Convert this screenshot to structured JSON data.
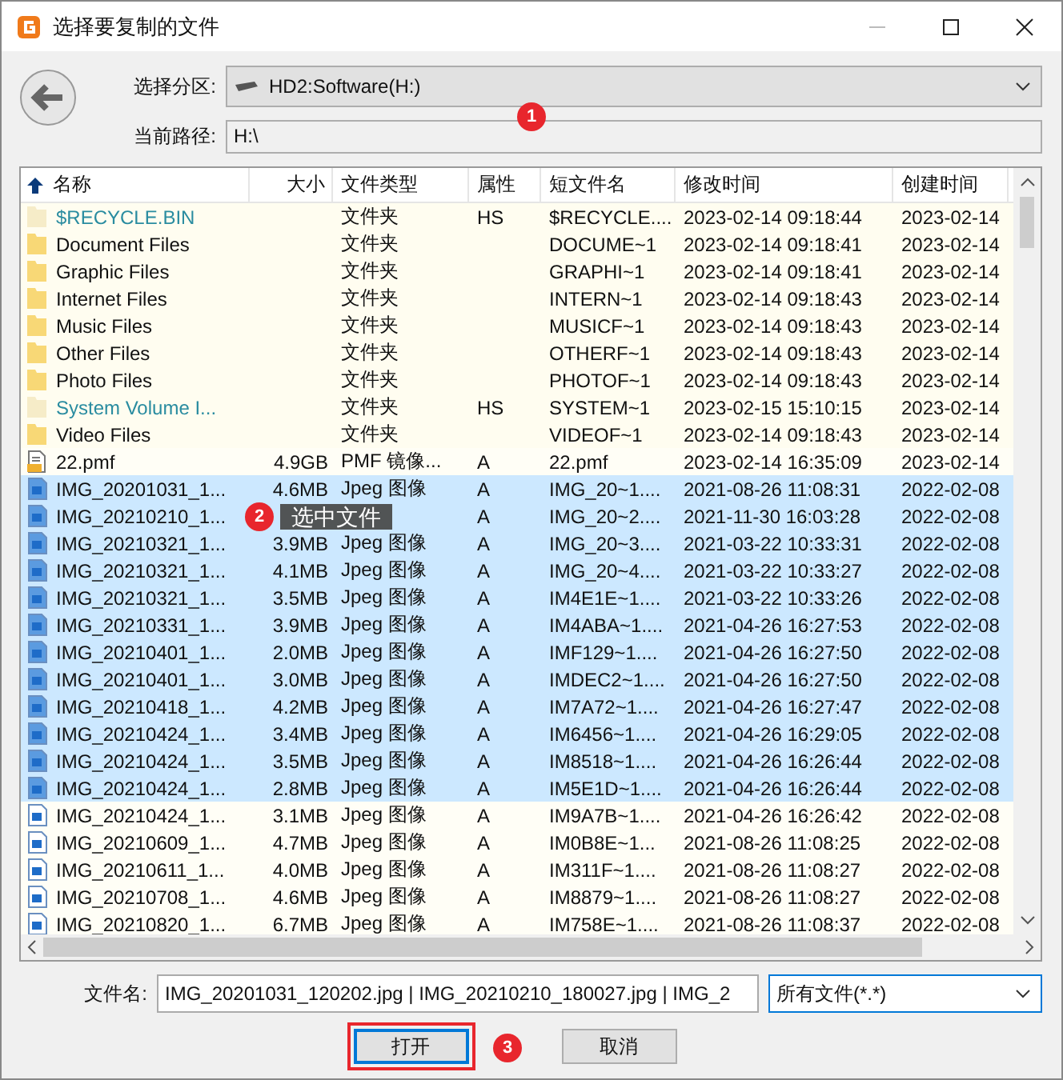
{
  "window": {
    "title": "选择要复制的文件"
  },
  "partition": {
    "label": "选择分区:",
    "value": "HD2:Software(H:)"
  },
  "path": {
    "label": "当前路径:",
    "value": "H:\\"
  },
  "files": {
    "columns": [
      "名称",
      "大小",
      "文件类型",
      "属性",
      "短文件名",
      "修改时间",
      "创建时间"
    ],
    "rows": [
      {
        "kind": "folder",
        "hidden": true,
        "selected": false,
        "name": "$RECYCLE.BIN",
        "type": "文件夹",
        "attr": "HS",
        "short": "$RECYCLE....",
        "modified": "2023-02-14 09:18:44",
        "created": "2023-02-14"
      },
      {
        "kind": "folder",
        "hidden": false,
        "selected": false,
        "name": "Document Files",
        "type": "文件夹",
        "short": "DOCUME~1",
        "modified": "2023-02-14 09:18:41",
        "created": "2023-02-14"
      },
      {
        "kind": "folder",
        "hidden": false,
        "selected": false,
        "name": "Graphic Files",
        "type": "文件夹",
        "short": "GRAPHI~1",
        "modified": "2023-02-14 09:18:41",
        "created": "2023-02-14"
      },
      {
        "kind": "folder",
        "hidden": false,
        "selected": false,
        "name": "Internet Files",
        "type": "文件夹",
        "short": "INTERN~1",
        "modified": "2023-02-14 09:18:43",
        "created": "2023-02-14"
      },
      {
        "kind": "folder",
        "hidden": false,
        "selected": false,
        "name": "Music Files",
        "type": "文件夹",
        "short": "MUSICF~1",
        "modified": "2023-02-14 09:18:43",
        "created": "2023-02-14"
      },
      {
        "kind": "folder",
        "hidden": false,
        "selected": false,
        "name": "Other Files",
        "type": "文件夹",
        "short": "OTHERF~1",
        "modified": "2023-02-14 09:18:43",
        "created": "2023-02-14"
      },
      {
        "kind": "folder",
        "hidden": false,
        "selected": false,
        "name": "Photo Files",
        "type": "文件夹",
        "short": "PHOTOF~1",
        "modified": "2023-02-14 09:18:43",
        "created": "2023-02-14"
      },
      {
        "kind": "folder",
        "hidden": true,
        "selected": false,
        "name": "System Volume I...",
        "type": "文件夹",
        "attr": "HS",
        "short": "SYSTEM~1",
        "modified": "2023-02-15 15:10:15",
        "created": "2023-02-14"
      },
      {
        "kind": "folder",
        "hidden": false,
        "selected": false,
        "name": "Video Files",
        "type": "文件夹",
        "short": "VIDEOF~1",
        "modified": "2023-02-14 09:18:43",
        "created": "2023-02-14"
      },
      {
        "kind": "file",
        "hidden": false,
        "selected": false,
        "name": "22.pmf",
        "size": "4.9GB",
        "type": "PMF 镜像...",
        "attr": "A",
        "short": "22.pmf",
        "modified": "2023-02-14 16:35:09",
        "created": "2023-02-14"
      },
      {
        "kind": "image",
        "hidden": false,
        "selected": true,
        "name": "IMG_20201031_1...",
        "size": "4.6MB",
        "type": "Jpeg 图像",
        "attr": "A",
        "short": "IMG_20~1....",
        "modified": "2021-08-26 11:08:31",
        "created": "2022-02-08"
      },
      {
        "kind": "image",
        "hidden": false,
        "selected": true,
        "name": "IMG_20210210_1...",
        "attr": "A",
        "short": "IMG_20~2....",
        "modified": "2021-11-30 16:03:28",
        "created": "2022-02-08"
      },
      {
        "kind": "image",
        "hidden": false,
        "selected": true,
        "name": "IMG_20210321_1...",
        "size": "3.9MB",
        "type": "Jpeg 图像",
        "attr": "A",
        "short": "IMG_20~3....",
        "modified": "2021-03-22 10:33:31",
        "created": "2022-02-08"
      },
      {
        "kind": "image",
        "hidden": false,
        "selected": true,
        "name": "IMG_20210321_1...",
        "size": "4.1MB",
        "type": "Jpeg 图像",
        "attr": "A",
        "short": "IMG_20~4....",
        "modified": "2021-03-22 10:33:27",
        "created": "2022-02-08"
      },
      {
        "kind": "image",
        "hidden": false,
        "selected": true,
        "name": "IMG_20210321_1...",
        "size": "3.5MB",
        "type": "Jpeg 图像",
        "attr": "A",
        "short": "IM4E1E~1....",
        "modified": "2021-03-22 10:33:26",
        "created": "2022-02-08"
      },
      {
        "kind": "image",
        "hidden": false,
        "selected": true,
        "name": "IMG_20210331_1...",
        "size": "3.9MB",
        "type": "Jpeg 图像",
        "attr": "A",
        "short": "IM4ABA~1....",
        "modified": "2021-04-26 16:27:53",
        "created": "2022-02-08"
      },
      {
        "kind": "image",
        "hidden": false,
        "selected": true,
        "name": "IMG_20210401_1...",
        "size": "2.0MB",
        "type": "Jpeg 图像",
        "attr": "A",
        "short": "IMF129~1....",
        "modified": "2021-04-26 16:27:50",
        "created": "2022-02-08"
      },
      {
        "kind": "image",
        "hidden": false,
        "selected": true,
        "name": "IMG_20210401_1...",
        "size": "3.0MB",
        "type": "Jpeg 图像",
        "attr": "A",
        "short": "IMDEC2~1....",
        "modified": "2021-04-26 16:27:50",
        "created": "2022-02-08"
      },
      {
        "kind": "image",
        "hidden": false,
        "selected": true,
        "name": "IMG_20210418_1...",
        "size": "4.2MB",
        "type": "Jpeg 图像",
        "attr": "A",
        "short": "IM7A72~1....",
        "modified": "2021-04-26 16:27:47",
        "created": "2022-02-08"
      },
      {
        "kind": "image",
        "hidden": false,
        "selected": true,
        "name": "IMG_20210424_1...",
        "size": "3.4MB",
        "type": "Jpeg 图像",
        "attr": "A",
        "short": "IM6456~1....",
        "modified": "2021-04-26 16:29:05",
        "created": "2022-02-08"
      },
      {
        "kind": "image",
        "hidden": false,
        "selected": true,
        "name": "IMG_20210424_1...",
        "size": "3.5MB",
        "type": "Jpeg 图像",
        "attr": "A",
        "short": "IM8518~1....",
        "modified": "2021-04-26 16:26:44",
        "created": "2022-02-08"
      },
      {
        "kind": "image",
        "hidden": false,
        "selected": true,
        "name": "IMG_20210424_1...",
        "size": "2.8MB",
        "type": "Jpeg 图像",
        "attr": "A",
        "short": "IM5E1D~1....",
        "modified": "2021-04-26 16:26:44",
        "created": "2022-02-08"
      },
      {
        "kind": "image",
        "hidden": false,
        "selected": false,
        "name": "IMG_20210424_1...",
        "size": "3.1MB",
        "type": "Jpeg 图像",
        "attr": "A",
        "short": "IM9A7B~1....",
        "modified": "2021-04-26 16:26:42",
        "created": "2022-02-08"
      },
      {
        "kind": "image",
        "hidden": false,
        "selected": false,
        "name": "IMG_20210609_1...",
        "size": "4.7MB",
        "type": "Jpeg 图像",
        "attr": "A",
        "short": "IM0B8E~1...",
        "modified": "2021-08-26 11:08:25",
        "created": "2022-02-08"
      },
      {
        "kind": "image",
        "hidden": false,
        "selected": false,
        "name": "IMG_20210611_1...",
        "size": "4.0MB",
        "type": "Jpeg 图像",
        "attr": "A",
        "short": "IM311F~1....",
        "modified": "2021-08-26 11:08:27",
        "created": "2022-02-08"
      },
      {
        "kind": "image",
        "hidden": false,
        "selected": false,
        "name": "IMG_20210708_1...",
        "size": "4.6MB",
        "type": "Jpeg 图像",
        "attr": "A",
        "short": "IM8879~1....",
        "modified": "2021-08-26 11:08:27",
        "created": "2022-02-08"
      },
      {
        "kind": "image",
        "hidden": false,
        "selected": false,
        "name": "IMG_20210820_1...",
        "size": "6.7MB",
        "type": "Jpeg 图像",
        "attr": "A",
        "short": "IM758E~1....",
        "modified": "2021-08-26 11:08:37",
        "created": "2022-02-08"
      }
    ]
  },
  "filename": {
    "label": "文件名:",
    "value": "IMG_20201031_120202.jpg | IMG_20210210_180027.jpg | IMG_2"
  },
  "filter": {
    "value": "所有文件(*.*)"
  },
  "buttons": [
    {
      "label": "打开",
      "highlighted": true
    },
    {
      "label": "取消",
      "highlighted": false
    }
  ],
  "annotations": [
    {
      "number": "1"
    },
    {
      "number": "2",
      "tooltip": "选中文件"
    },
    {
      "number": "3"
    }
  ]
}
